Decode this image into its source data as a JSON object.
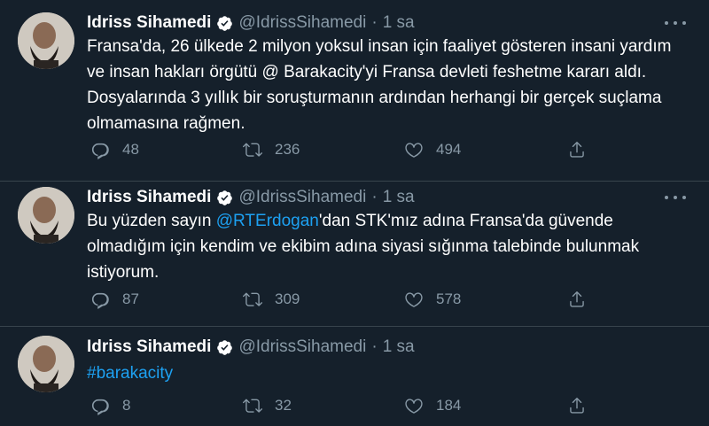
{
  "tweets": [
    {
      "name": "Idriss Sihamedi",
      "handle": "@IdrissSihamedi",
      "time": "1 sa",
      "text": "Fransa'da, 26 ülkede 2 milyon yoksul insan için faaliyet gösteren insani yardım ve insan hakları örgütü @ Barakacity'yi Fransa devleti feshetme kararı aldı. Dosyalarında 3 yıllık bir soruşturmanın ardından herhangi bir gerçek suçlama olmamasına rağmen.",
      "replies": "48",
      "retweets": "236",
      "likes": "494"
    },
    {
      "name": "Idriss Sihamedi",
      "handle": "@IdrissSihamedi",
      "time": "1 sa",
      "text_before": "Bu yüzden sayın ",
      "mention": "@RTErdogan",
      "text_after": "'dan STK'mız adına Fransa'da güvende olmadığım için kendim ve ekibim adına siyasi sığınma talebinde bulunmak istiyorum.",
      "replies": "87",
      "retweets": "309",
      "likes": "578"
    },
    {
      "name": "Idriss Sihamedi",
      "handle": "@IdrissSihamedi",
      "time": "1 sa",
      "hashtag": "#barakacity",
      "replies": "8",
      "retweets": "32",
      "likes": "184"
    }
  ],
  "icons": {
    "verified": "verified-badge-icon",
    "more": "more-options-icon",
    "reply": "reply-icon",
    "retweet": "retweet-icon",
    "like": "like-icon",
    "share": "share-icon"
  },
  "colors": {
    "background": "#15202b",
    "text": "#ffffff",
    "secondary": "#8899a6",
    "link": "#1da1f2",
    "divider": "#38444d"
  }
}
